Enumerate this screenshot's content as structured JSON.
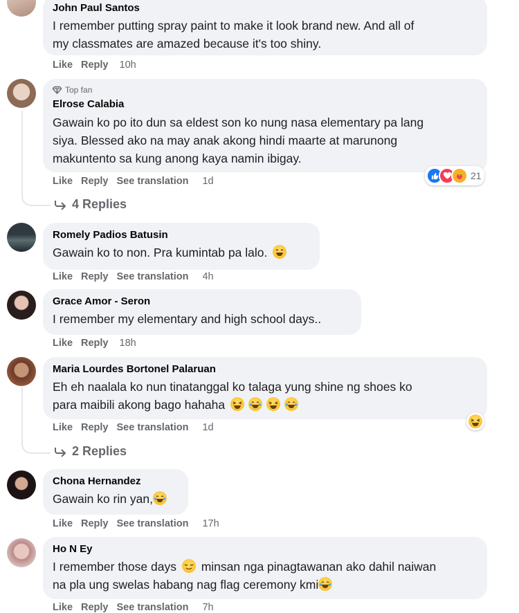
{
  "comments": [
    {
      "name": "John Paul Santos",
      "text": "I remember putting spray paint to make it look brand new. And all of\nmy classmates are amazed because it's too shiny.",
      "actions": [
        "Like",
        "Reply"
      ],
      "time": "10h"
    },
    {
      "badge": "Top fan",
      "name": "Elrose Calabia",
      "text": "Gawain ko po ito dun sa eldest son ko nung nasa elementary pa lang\nsiya. Blessed ako na may anak akong hindi maarte at marunong\nmakuntento sa kung anong kaya namin ibigay.",
      "actions": [
        "Like",
        "Reply",
        "See translation"
      ],
      "time": "1d",
      "reaction_count": "21",
      "replies": "4 Replies"
    },
    {
      "name": "Romely Padios Batusin",
      "text": "Gawain ko to non. Pra kumintab pa lalo.",
      "actions": [
        "Like",
        "Reply",
        "See translation"
      ],
      "time": "4h"
    },
    {
      "name": "Grace Amor - Seron",
      "text": "I remember my elementary and high school days..",
      "actions": [
        "Like",
        "Reply"
      ],
      "time": "18h"
    },
    {
      "name": "Maria Lourdes Bortonel Palaruan",
      "text": "Eh eh naalala ko nun tinatanggal ko talaga yung shine ng shoes ko\npara maibili akong bago hahaha",
      "actions": [
        "Like",
        "Reply",
        "See translation"
      ],
      "time": "1d",
      "replies": "2 Replies"
    },
    {
      "name": "Chona Hernandez",
      "text": "Gawain ko rin yan,",
      "actions": [
        "Like",
        "Reply",
        "See translation"
      ],
      "time": "17h"
    },
    {
      "name": "Ho N Ey",
      "text_a": "I remember those days",
      "text_b": " minsan nga pinagtawanan ako dahil naiwan\nna pla ung swelas habang nag flag ceremony kmi",
      "actions": [
        "Like",
        "Reply",
        "See translation"
      ],
      "time": "7h"
    }
  ],
  "colors": {
    "bubble": "#f0f2f5",
    "secondary_text": "#65676b",
    "like_blue": "#1877f2",
    "love_red": "#f33e58"
  },
  "icons": [
    "diamond-icon",
    "reply-arrow-icon",
    "like-reaction-icon",
    "love-reaction-icon",
    "care-reaction-icon",
    "laugh-emoji-icon",
    "smile-emoji-icon",
    "relieved-emoji-icon"
  ]
}
